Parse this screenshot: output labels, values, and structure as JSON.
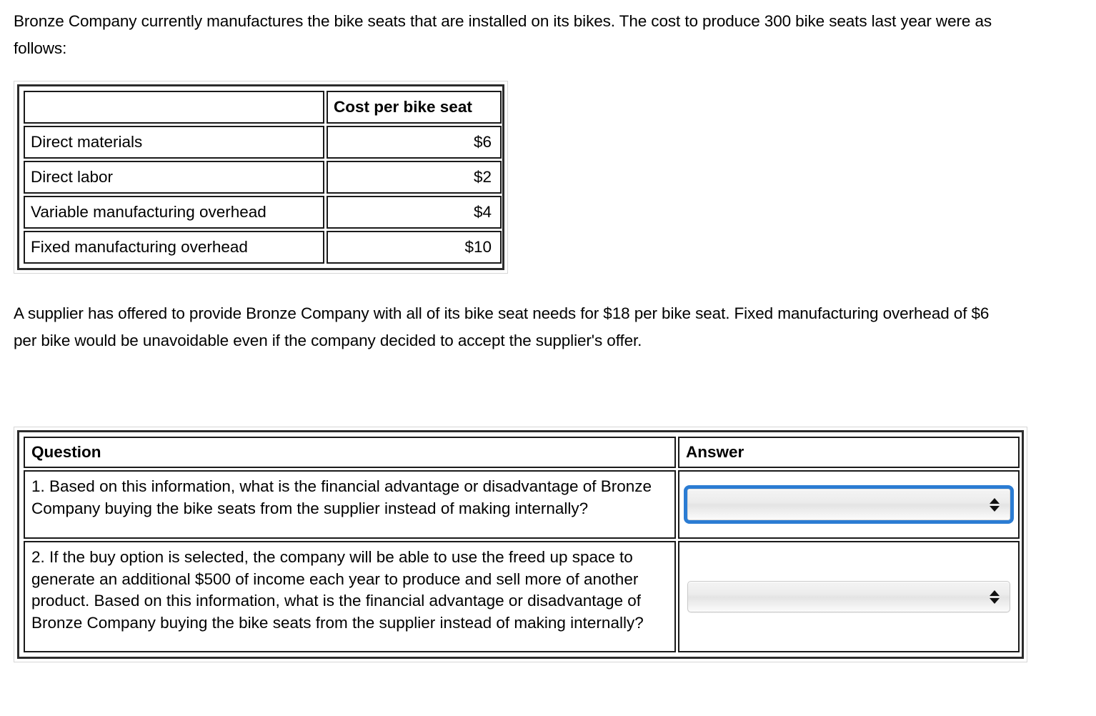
{
  "intro_paragraph": "Bronze Company currently manufactures the bike seats that are installed on its bikes.  The cost to produce 300 bike seats last year were as follows:",
  "supplier_paragraph": "A supplier has offered to provide Bronze Company with all of its bike seat needs for $18 per bike seat.  Fixed manufacturing overhead of $6 per bike would be unavoidable even if the company decided to accept the supplier's offer.",
  "cost_table": {
    "headers": [
      "",
      "Cost per bike seat"
    ],
    "rows": [
      {
        "label": "Direct materials",
        "value": "$6"
      },
      {
        "label": "Direct labor",
        "value": "$2"
      },
      {
        "label": "Variable manufacturing overhead",
        "value": "$4"
      },
      {
        "label": "Fixed manufacturing overhead",
        "value": "$10"
      }
    ]
  },
  "qa_table": {
    "headers": {
      "question": "Question",
      "answer": "Answer"
    },
    "rows": [
      {
        "question": "1. Based on this information,  what is the financial advantage or disadvantage of Bronze Company buying the bike seats from the supplier instead of making internally?",
        "answer_value": "",
        "answer_placeholder": "",
        "focused": true
      },
      {
        "question": "2. If the buy option is selected, the company will be able to use the freed up space to generate an additional $500 of income each year to produce and sell more of another product.  Based on this information,  what is the financial advantage or disadvantage of Bronze Company buying the bike seats from the supplier instead of making internally?",
        "answer_value": "",
        "answer_placeholder": "",
        "focused": false
      }
    ]
  },
  "colors": {
    "focus_ring": "#2b7cd3",
    "cell_border": "#1a1a1a",
    "frame_border": "#2b2b2b",
    "text": "#000000",
    "page_background": "#ffffff"
  }
}
